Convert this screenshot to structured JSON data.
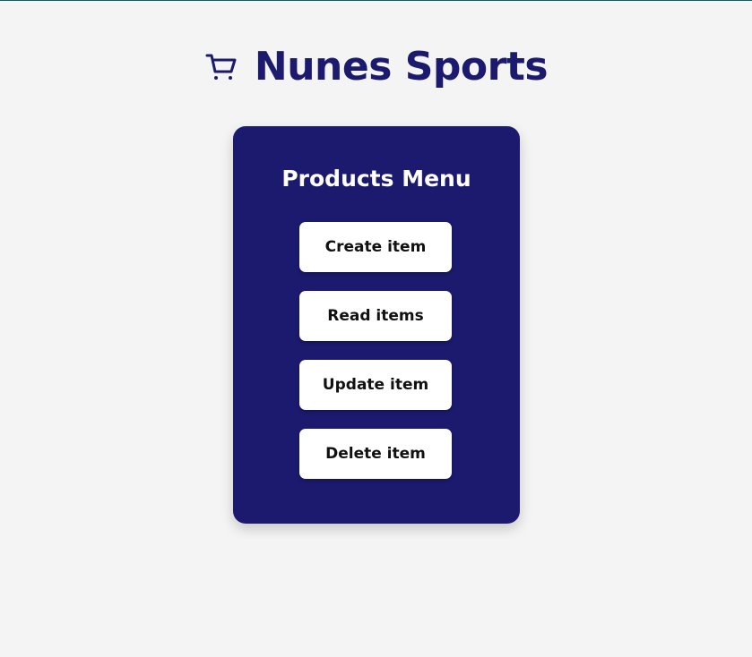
{
  "header": {
    "icon": "shopping-cart-icon",
    "title": "Nunes Sports"
  },
  "menu": {
    "title": "Products Menu",
    "buttons": {
      "create": "Create item",
      "read": "Read items",
      "update": "Update item",
      "delete": "Delete item"
    }
  },
  "colors": {
    "primary": "#1b1a6e",
    "background": "#f4f4f4",
    "button_bg": "#ffffff",
    "top_border": "#0d5c6b"
  }
}
